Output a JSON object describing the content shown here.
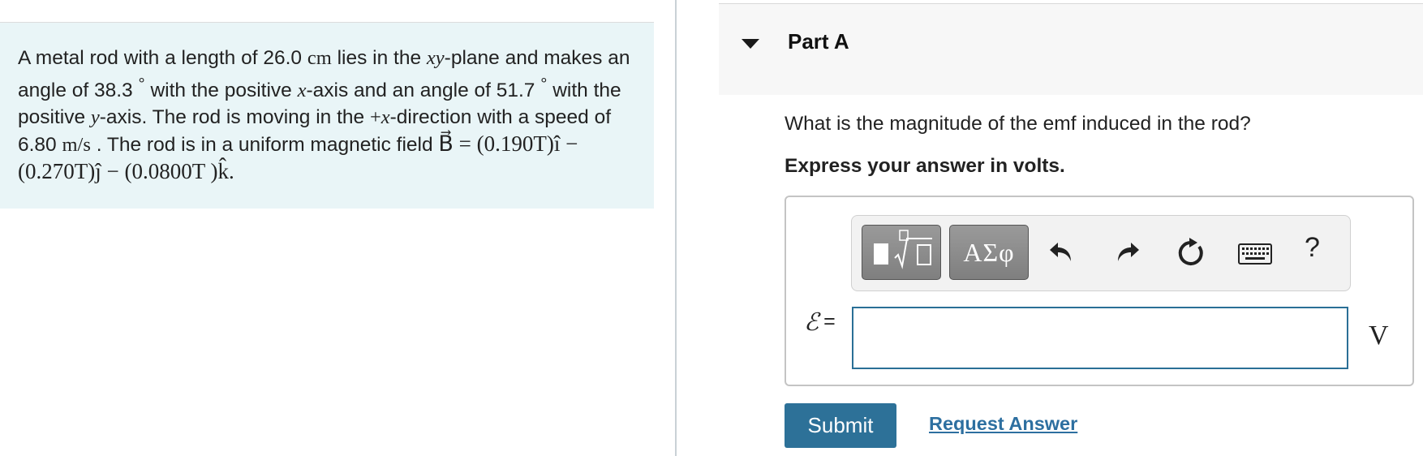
{
  "problem": {
    "s1": "A metal rod with a length of 26.0 ",
    "len_unit": "cm",
    "s2": " lies in the ",
    "plane_var": "xy",
    "s3": "-plane and makes an angle of 38.3 ",
    "deg1": "°",
    "s4": " with the positive ",
    "x_var1": "x",
    "s5": "-axis and an angle of 51.7 ",
    "deg2": "°",
    "s6": " with the positive ",
    "y_var": "y",
    "s7": "-axis. The rod is moving in the ",
    "dir_sign": "+",
    "x_var2": "x",
    "s8": "-direction with a speed of 6.80 ",
    "speed_unit": "m/s",
    "s9": " . The rod is in a uniform magnetic field ",
    "field_expr": "B⃗ = (0.190T)î − (0.270T)ĵ − (0.0800T )k̂."
  },
  "part": {
    "title": "Part A",
    "question": "What is the magnitude of the emf induced in the rod?",
    "instruction": "Express your answer in volts."
  },
  "toolbar": {
    "templates_icon": "templates-icon",
    "symbols_label": "ΑΣφ",
    "help_label": "?"
  },
  "answer": {
    "variable": "ℰ",
    "equals": "=",
    "value": "",
    "unit": "V"
  },
  "actions": {
    "submit_label": "Submit",
    "request_label": "Request Answer"
  },
  "colors": {
    "problem_bg": "#e9f5f7",
    "accent": "#2d7198",
    "link": "#2d6fa0"
  }
}
